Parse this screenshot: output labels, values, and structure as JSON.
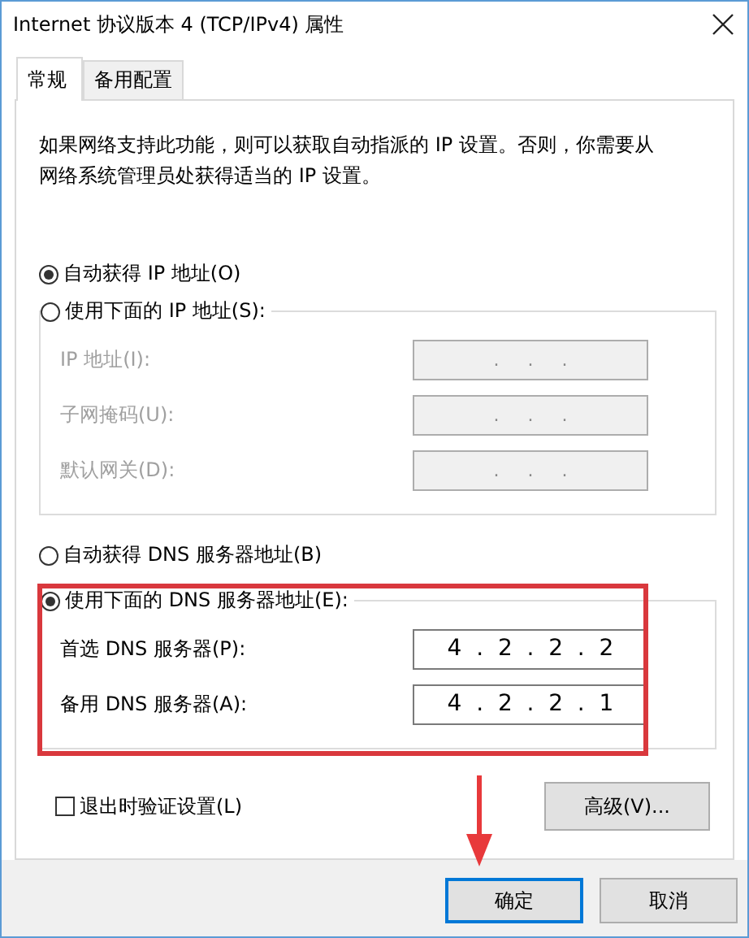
{
  "window": {
    "title": "Internet 协议版本 4 (TCP/IPv4) 属性"
  },
  "tabs": [
    {
      "label": "常规",
      "selected": true
    },
    {
      "label": "备用配置",
      "selected": false
    }
  ],
  "description": "如果网络支持此功能，则可以获取自动指派的 IP 设置。否则，你需要从网络系统管理员处获得适当的 IP 设置。",
  "ip_options": [
    {
      "label": "自动获得 IP 地址(O)",
      "selected": true
    },
    {
      "label": "使用下面的 IP 地址(S):",
      "selected": false
    }
  ],
  "ip_fields": {
    "disabled": true,
    "items": [
      {
        "label": "IP 地址(I):",
        "value": ".     .     ."
      },
      {
        "label": "子网掩码(U):",
        "value": ".     .     ."
      },
      {
        "label": "默认网关(D):",
        "value": ".     .     ."
      }
    ]
  },
  "dns_options": [
    {
      "label": "自动获得 DNS 服务器地址(B)",
      "selected": false
    },
    {
      "label": "使用下面的 DNS 服务器地址(E):",
      "selected": true
    }
  ],
  "dns_fields": {
    "disabled": false,
    "items": [
      {
        "label": "首选 DNS 服务器(P):",
        "value": "4  .  2  .  2  .  2"
      },
      {
        "label": "备用 DNS 服务器(A):",
        "value": "4  .  2  .  2  .  1"
      }
    ]
  },
  "validate_checkbox": {
    "label": "退出时验证设置(L)",
    "checked": false
  },
  "advanced_button": "高级(V)...",
  "buttons": [
    {
      "label": "确定",
      "default": true
    },
    {
      "label": "取消",
      "default": false
    }
  ]
}
